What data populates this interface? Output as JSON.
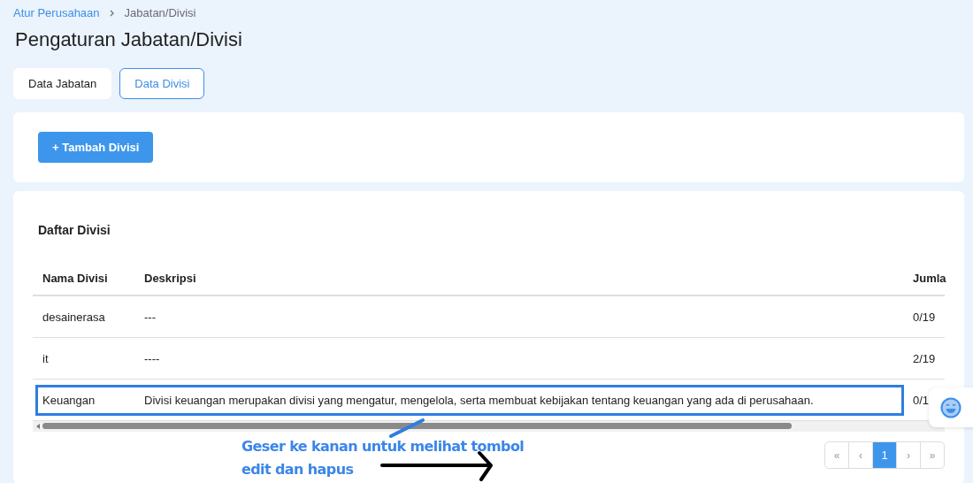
{
  "breadcrumb": [
    {
      "label": "Atur Perusahaan",
      "link": true
    },
    {
      "label": "Jabatan/Divisi",
      "link": false
    }
  ],
  "title": "Pengaturan Jabatan/Divisi",
  "tabs": [
    {
      "label": "Data Jabatan",
      "selected": false
    },
    {
      "label": "Data Divisi",
      "selected": true
    }
  ],
  "add_button": "+ Tambah Divisi",
  "table": {
    "title": "Daftar Divisi",
    "columns": [
      "Nama Divisi",
      "Deskripsi",
      "Jumla"
    ],
    "rows": [
      {
        "cells": [
          "desainerasa",
          "---",
          "0/19"
        ],
        "highlighted": false
      },
      {
        "cells": [
          "it",
          "----",
          "2/19"
        ],
        "highlighted": false
      },
      {
        "cells": [
          "Keuangan",
          "Divisi keuangan merupakan divisi yang mengatur, mengelola, serta membuat kebijakan tentang keuangan yang ada di perusahaan.",
          "0/1"
        ],
        "highlighted": true
      }
    ]
  },
  "pagination": [
    {
      "label": "«",
      "selected": false
    },
    {
      "label": "‹",
      "selected": false
    },
    {
      "label": "1",
      "selected": true
    },
    {
      "label": "›",
      "selected": false
    },
    {
      "label": "»",
      "selected": false
    }
  ],
  "hint": [
    "Geser ke kanan untuk melihat tombol",
    "edit dan hapus"
  ]
}
